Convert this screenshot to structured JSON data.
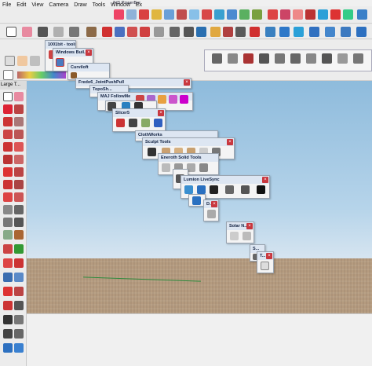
{
  "menu": {
    "items": [
      "File",
      "Edit",
      "View",
      "Camera",
      "Draw",
      "Tools",
      "Window",
      "Ex"
    ]
  },
  "powerbar": {
    "title": "JHS PowerBar"
  },
  "left_toolbar": {
    "title": "Large T..."
  },
  "floating_toolbars": [
    {
      "id": "1001bit",
      "title": "1001bit - tools"
    },
    {
      "id": "windows-builder",
      "title": "Windows Buil..."
    },
    {
      "id": "curviloft",
      "title": "Curviloft"
    },
    {
      "id": "fredo6-joint",
      "title": "Fredo6_JointPushPull"
    },
    {
      "id": "toposh",
      "title": "TopoSh..."
    },
    {
      "id": "maj-followme",
      "title": "MAJ FollowMe"
    },
    {
      "id": "slicer5",
      "title": "Slicer5"
    },
    {
      "id": "clothworks",
      "title": "ClothWorks"
    },
    {
      "id": "sculpt-tools",
      "title": "Sculpt Tools"
    },
    {
      "id": "eneroth-solid",
      "title": "Eneroth Solid Tools"
    },
    {
      "id": "lumion-livesync",
      "title": "Lumion LiveSync"
    },
    {
      "id": "d",
      "title": "D..."
    },
    {
      "id": "solar-n",
      "title": "Solar N..."
    },
    {
      "id": "s",
      "title": "S..."
    },
    {
      "id": "t",
      "title": "T..."
    }
  ],
  "colors": {
    "sky_top": "#8ebbdc",
    "ground": "#b59b7f",
    "title_bar": "#dde6f2",
    "close": "#c8373e"
  }
}
